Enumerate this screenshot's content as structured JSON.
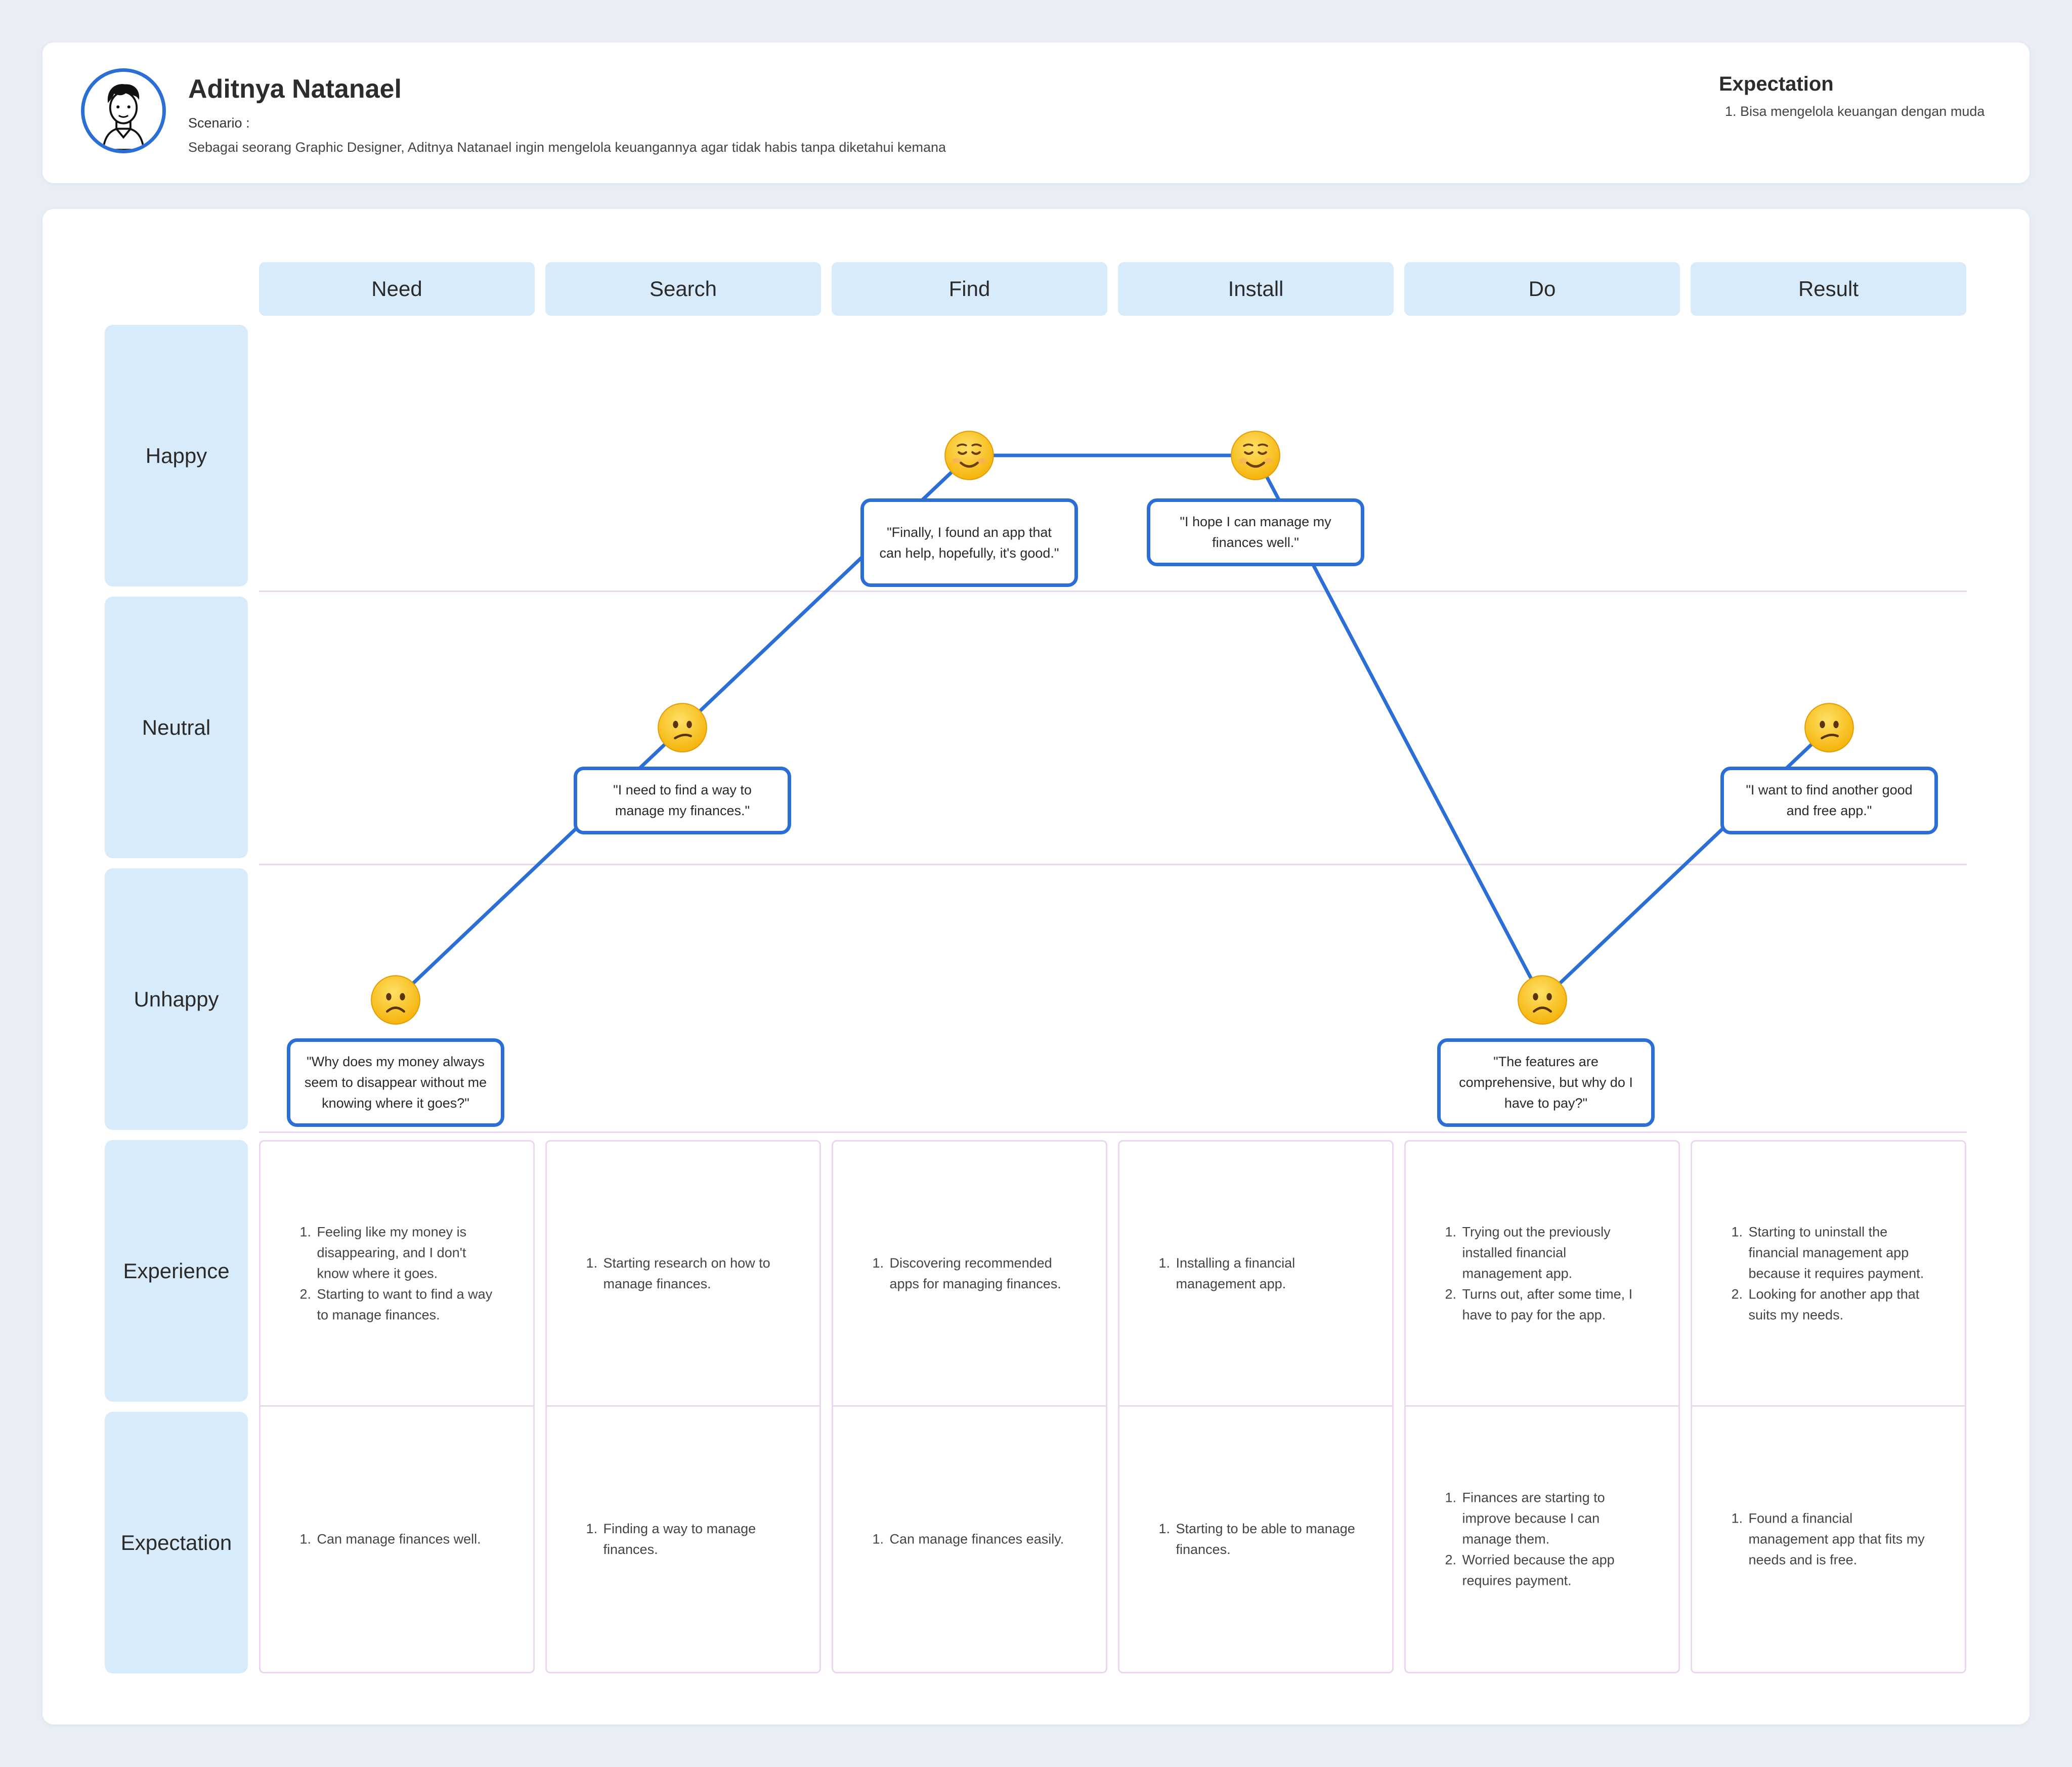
{
  "persona": {
    "name": "Aditnya Natanael",
    "scenario_label": "Scenario :",
    "scenario": "Sebagai seorang Graphic Designer, Aditnya Natanael ingin mengelola keuangannya agar tidak habis tanpa diketahui kemana"
  },
  "header_expectation": {
    "title": "Expectation",
    "items": [
      "Bisa mengelola keuangan dengan muda"
    ]
  },
  "stages": [
    "Need",
    "Search",
    "Find",
    "Install",
    "Do",
    "Result"
  ],
  "row_labels": [
    "Happy",
    "Neutral",
    "Unhappy",
    "Experience",
    "Expectation"
  ],
  "journey": [
    {
      "stage": "Need",
      "mood": "Unhappy",
      "emoji": "frowning-face",
      "quote": "\"Why does my money always seem to disappear without me knowing where it goes?\""
    },
    {
      "stage": "Search",
      "mood": "Neutral",
      "emoji": "confused-face",
      "quote": "\"I need to find a way to manage my finances.\""
    },
    {
      "stage": "Find",
      "mood": "Happy",
      "emoji": "smiling-face",
      "quote": "\"Finally, I found an app that can help, hopefully, it's good.\""
    },
    {
      "stage": "Install",
      "mood": "Happy",
      "emoji": "smiling-face",
      "quote": "\"I hope I can manage my finances well.\""
    },
    {
      "stage": "Do",
      "mood": "Unhappy",
      "emoji": "frowning-face",
      "quote": "\"The features are comprehensive, but why do I have to pay?\""
    },
    {
      "stage": "Result",
      "mood": "Neutral",
      "emoji": "confused-face",
      "quote": "\"I want to find another good and free app.\""
    }
  ],
  "experience": [
    [
      "Feeling like my money is disappearing, and I don't know where it goes.",
      "Starting to want to find a way to manage finances."
    ],
    [
      "Starting research on how to manage finances."
    ],
    [
      "Discovering recommended apps for managing finances."
    ],
    [
      "Installing a financial management app."
    ],
    [
      "Trying out the previously installed financial management app.",
      "Turns out, after some time, I have to pay for the app."
    ],
    [
      "Starting to uninstall the financial management app because it requires payment.",
      "Looking for another app that suits my needs."
    ]
  ],
  "expectation": [
    [
      "Can manage finances well."
    ],
    [
      "Finding a way to manage finances."
    ],
    [
      "Can manage finances easily."
    ],
    [
      "Starting to be able to manage finances."
    ],
    [
      "Finances are starting to improve because I can manage them.",
      "Worried because the app requires payment."
    ],
    [
      "Found a financial management app that fits my needs and is free."
    ]
  ],
  "colors": {
    "line": "#2b6fd6",
    "label_bg": "#d8ebfb",
    "grid": "#ead6ef",
    "page_bg": "#e9eef5"
  }
}
